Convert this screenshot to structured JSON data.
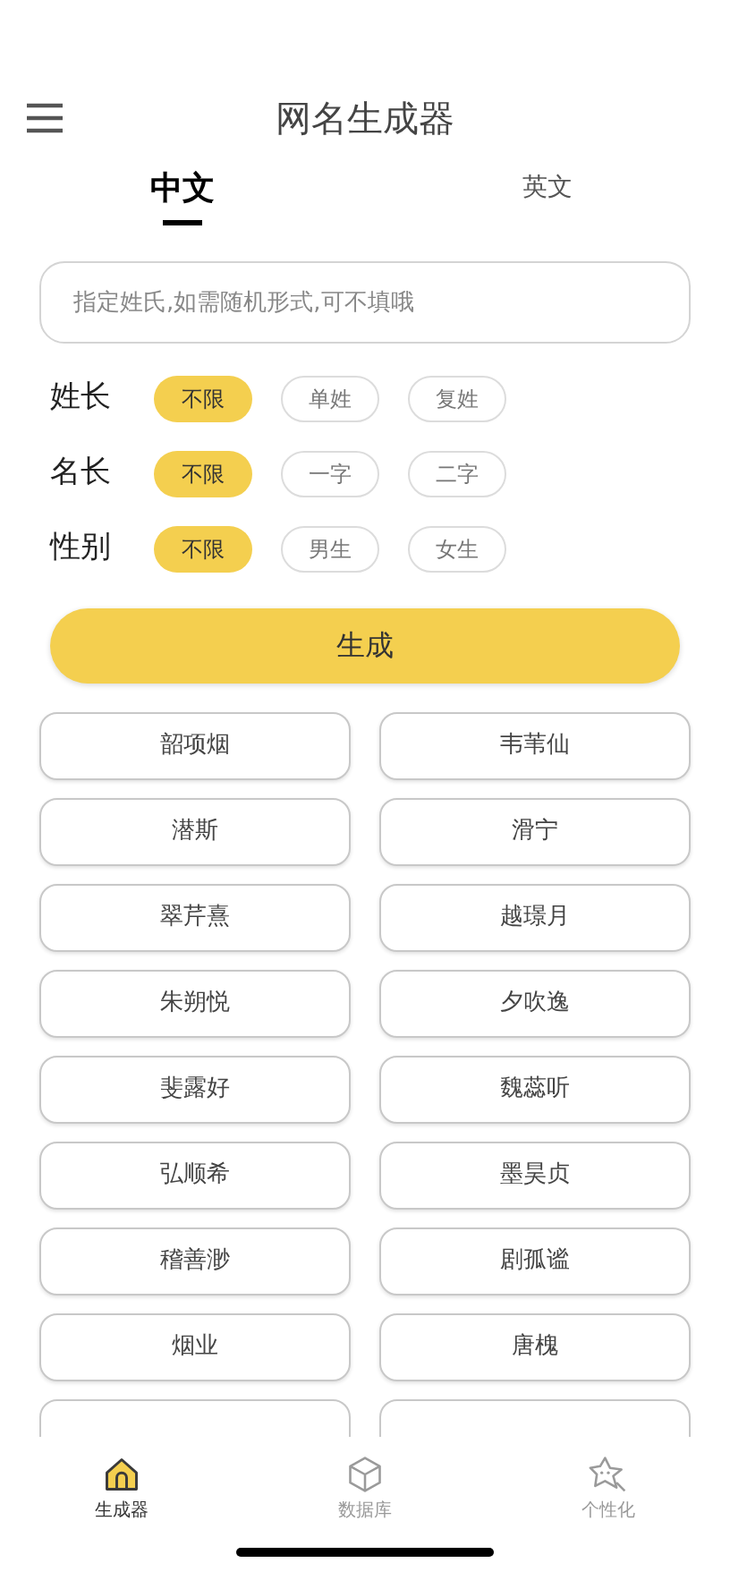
{
  "header": {
    "title": "网名生成器"
  },
  "tabs": [
    {
      "label": "中文",
      "selected": true
    },
    {
      "label": "英文",
      "selected": false
    }
  ],
  "surname_input": {
    "placeholder": "指定姓氏,如需随机形式,可不填哦"
  },
  "options": [
    {
      "label": "姓长",
      "choices": [
        {
          "label": "不限",
          "selected": true
        },
        {
          "label": "单姓",
          "selected": false
        },
        {
          "label": "复姓",
          "selected": false
        }
      ]
    },
    {
      "label": "名长",
      "choices": [
        {
          "label": "不限",
          "selected": true
        },
        {
          "label": "一字",
          "selected": false
        },
        {
          "label": "二字",
          "selected": false
        }
      ]
    },
    {
      "label": "性别",
      "choices": [
        {
          "label": "不限",
          "selected": true
        },
        {
          "label": "男生",
          "selected": false
        },
        {
          "label": "女生",
          "selected": false
        }
      ]
    }
  ],
  "generate_button": "生成",
  "names": [
    "韶项烟",
    "韦苇仙",
    "潜斯",
    "滑宁",
    "翠芹熹",
    "越璟月",
    "朱朔悦",
    "夕吹逸",
    "斐露好",
    "魏蕊听",
    "弘顺希",
    "墨昊贞",
    "稽善渺",
    "剧孤谧",
    "烟业",
    "唐槐"
  ],
  "bottom_nav": [
    {
      "label": "生成器",
      "selected": true
    },
    {
      "label": "数据库",
      "selected": false
    },
    {
      "label": "个性化",
      "selected": false
    }
  ]
}
